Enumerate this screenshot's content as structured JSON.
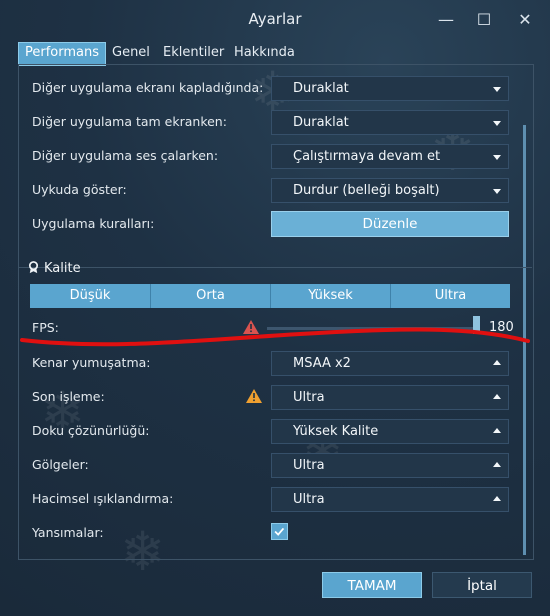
{
  "window": {
    "title": "Ayarlar"
  },
  "tabs": [
    {
      "label": "Performans",
      "active": true
    },
    {
      "label": "Genel",
      "active": false
    },
    {
      "label": "Eklentiler",
      "active": false
    },
    {
      "label": "Hakkında",
      "active": false
    }
  ],
  "performance": {
    "rows": [
      {
        "label": "Diğer uygulama ekranı kapladığında:",
        "value": "Duraklat"
      },
      {
        "label": "Diğer uygulama tam ekranken:",
        "value": "Duraklat"
      },
      {
        "label": "Diğer uygulama ses çalarken:",
        "value": "Çalıştırmaya devam et"
      },
      {
        "label": "Uykuda göster:",
        "value": "Durdur (belleği boşalt)"
      }
    ],
    "app_rules": {
      "label": "Uygulama kuralları:",
      "button": "Düzenle"
    }
  },
  "quality": {
    "title": "Kalite",
    "presets": [
      "Düşük",
      "Orta",
      "Yüksek",
      "Ultra"
    ],
    "fps": {
      "label": "FPS:",
      "value": "180",
      "level": 1.0
    },
    "settings": [
      {
        "label": "Kenar yumuşatma:",
        "value": "MSAA x2"
      },
      {
        "label": "Son işleme:",
        "value": "Ultra"
      },
      {
        "label": "Doku çözünürlüğü:",
        "value": "Yüksek Kalite"
      },
      {
        "label": "Gölgeler:",
        "value": "Ultra"
      },
      {
        "label": "Hacimsel ışıklandırma:",
        "value": "Ultra"
      }
    ],
    "reflections": {
      "label": "Yansımalar:",
      "checked": true
    }
  },
  "footer": {
    "ok": "TAMAM",
    "cancel": "İptal"
  },
  "colors": {
    "accent": "#5aa5cf",
    "annotation": "#e01010",
    "warning_red": "#d9534f",
    "warning_orange": "#f0a030"
  }
}
